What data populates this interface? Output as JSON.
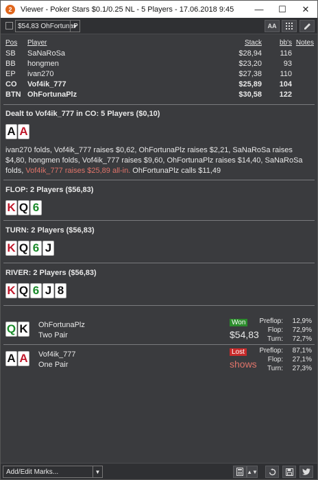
{
  "window": {
    "title": "Viewer - Poker Stars $0.1/0.25 NL - 5 Players - 17.06.2018 9:45",
    "app_icon": "2",
    "minimize": "—",
    "maximize": "☐",
    "close": "✕"
  },
  "toolbar": {
    "player_select": "$54,83 OhFortunaP",
    "font_button": "AA",
    "grid_icon": "grid-icon",
    "edit_icon": "pencil-icon"
  },
  "players_table": {
    "headers": {
      "pos": "Pos",
      "player": "Player",
      "stack": "Stack",
      "bbs": "bb's",
      "notes": "Notes"
    },
    "rows": [
      {
        "pos": "SB",
        "player": "SaNaRoSa",
        "stack": "$28,94",
        "bbs": "116",
        "bold": false
      },
      {
        "pos": "BB",
        "player": "hongmen",
        "stack": "$23,20",
        "bbs": "93",
        "bold": false
      },
      {
        "pos": "EP",
        "player": "ivan270",
        "stack": "$27,38",
        "bbs": "110",
        "bold": false
      },
      {
        "pos": "CO",
        "player": "Vof4ik_777",
        "stack": "$25,89",
        "bbs": "104",
        "bold": true
      },
      {
        "pos": "BTN",
        "player": "OhFortunaPlz",
        "stack": "$30,58",
        "bbs": "122",
        "bold": true
      }
    ]
  },
  "preflop": {
    "title": "Dealt to Vof4ik_777 in CO: 5 Players ($0,10)",
    "cards": [
      {
        "rank": "A",
        "suit_color": "black"
      },
      {
        "rank": "A",
        "suit_color": "red"
      }
    ],
    "actions_text": "ivan270 folds, Vof4ik_777 raises $0,62, OhFortunaPlz raises $2,21, SaNaRoSa raises $4,80, hongmen folds, Vof4ik_777 raises $9,60, OhFortunaPlz raises $14,40, SaNaRoSa folds, ",
    "allin_text": "Vof4ik_777 raises $25,89 all-in.",
    "call_text": " OhFortunaPlz calls $11,49"
  },
  "flop": {
    "title": "FLOP: 2 Players ($56,83)",
    "cards": [
      {
        "rank": "K",
        "suit_color": "red"
      },
      {
        "rank": "Q",
        "suit_color": "black"
      },
      {
        "rank": "6",
        "suit_color": "green"
      }
    ]
  },
  "turn": {
    "title": "TURN: 2 Players ($56,83)",
    "cards": [
      {
        "rank": "K",
        "suit_color": "red"
      },
      {
        "rank": "Q",
        "suit_color": "black"
      },
      {
        "rank": "6",
        "suit_color": "green"
      },
      {
        "rank": "J",
        "suit_color": "black"
      }
    ]
  },
  "river": {
    "title": "RIVER: 2 Players ($56,83)",
    "cards": [
      {
        "rank": "K",
        "suit_color": "red"
      },
      {
        "rank": "Q",
        "suit_color": "black"
      },
      {
        "rank": "6",
        "suit_color": "green"
      },
      {
        "rank": "J",
        "suit_color": "black"
      },
      {
        "rank": "8",
        "suit_color": "black"
      }
    ]
  },
  "showdown": [
    {
      "player": "OhFortunaPlz",
      "hand": "Two Pair",
      "cards": [
        {
          "rank": "Q",
          "suit_color": "green"
        },
        {
          "rank": "K",
          "suit_color": "black"
        }
      ],
      "result": "Won",
      "amount": "$54,83",
      "equity": {
        "preflop_label": "Preflop:",
        "preflop": "12,9%",
        "flop_label": "Flop:",
        "flop": "72,9%",
        "turn_label": "Turn:",
        "turn": "72,7%"
      }
    },
    {
      "player": "Vof4ik_777",
      "hand": "One Pair",
      "cards": [
        {
          "rank": "A",
          "suit_color": "black"
        },
        {
          "rank": "A",
          "suit_color": "red"
        }
      ],
      "result": "Lost",
      "amount": "shows",
      "equity": {
        "preflop_label": "Preflop:",
        "preflop": "87,1%",
        "flop_label": "Flop:",
        "flop": "27,1%",
        "turn_label": "Turn:",
        "turn": "27,3%"
      }
    }
  ],
  "bottombar": {
    "marks_select": "Add/Edit Marks..."
  },
  "colors": {
    "red_suit": "#c0182b",
    "green_suit": "#1a8a2a",
    "won": "#2c8c2c",
    "lost": "#c82b2b",
    "allin_text": "#e0746a"
  }
}
